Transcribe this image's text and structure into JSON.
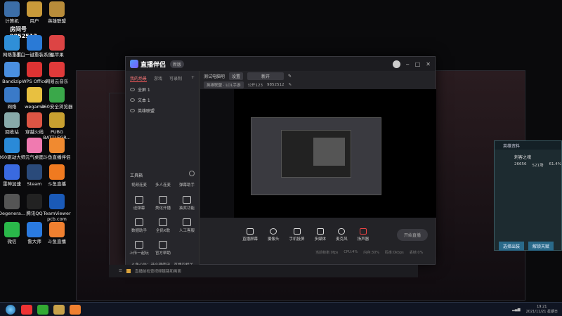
{
  "overlay": {
    "room_label": "房间号",
    "room_number": "9852512"
  },
  "desktop_icons": [
    {
      "label": "计算机",
      "color": "#3c6ea8"
    },
    {
      "label": "用户",
      "color": "#c99a3a"
    },
    {
      "label": "英雄联盟",
      "color": "#b88c3a"
    },
    {
      "label": "网络重置",
      "color": "#2f8fd8"
    },
    {
      "label": "小白一键重装系统",
      "color": "#2a7ad6"
    },
    {
      "label": "福苹果",
      "color": "#d44"
    },
    {
      "label": "Bandizip",
      "color": "#4a8fe0"
    },
    {
      "label": "WPS Office",
      "color": "#d33"
    },
    {
      "label": "网易云音乐",
      "color": "#e03a3a"
    },
    {
      "label": "网络",
      "color": "#3a7ac8"
    },
    {
      "label": "wegame",
      "color": "#e8c040"
    },
    {
      "label": "360安全浏览器",
      "color": "#3aa84a"
    },
    {
      "label": "回收站",
      "color": "#8aa"
    },
    {
      "label": "穿越火线",
      "color": "#d54"
    },
    {
      "label": "PUBG BATTLEGR...",
      "color": "#c8a030"
    },
    {
      "label": "360驱动大师",
      "color": "#2a8ad8"
    },
    {
      "label": "元气桌面",
      "color": "#f07ab0"
    },
    {
      "label": "斗鱼直播伴侣",
      "color": "#f08a30"
    },
    {
      "label": "雷神加速",
      "color": "#3a6ae0"
    },
    {
      "label": "Steam",
      "color": "#2a4a7a"
    },
    {
      "label": "斗鱼直播",
      "color": "#f07a20"
    },
    {
      "label": "Degenera...",
      "color": "#555"
    },
    {
      "label": "腾讯QQ",
      "color": "#222"
    },
    {
      "label": "TeamViewer pcb.com",
      "color": "#1a5ab8"
    },
    {
      "label": "微信",
      "color": "#2ab84a"
    },
    {
      "label": "鲁大师",
      "color": "#2a7ae0"
    },
    {
      "label": "斗鱼直播",
      "color": "#f08030"
    }
  ],
  "app": {
    "name": "直播伴侣",
    "version": "新版",
    "tabs": [
      "我的场景",
      "游戏",
      "可录制"
    ],
    "scenes": [
      "全屏 1",
      "文本 1",
      "英雄联盟"
    ],
    "tools_title": "工具箱",
    "tools": [
      "视频连麦",
      "多人连麦",
      "弹幕助手",
      "送弹幕",
      "美化开播",
      "抽奖功能",
      "数据助手",
      "全民K歌",
      "人工客服",
      "上传一起玩",
      "官方帮助"
    ],
    "preview_header": {
      "source": "测试电脑吧",
      "settings": "设置",
      "title": "新开"
    },
    "preview_sub": {
      "category": "英雄联盟 · LOL手游",
      "room_prefix": "公开123",
      "room_id": "9852512"
    },
    "bottom_actions": [
      "直播屏幕",
      "摄像头",
      "手机投屏",
      "多媒体",
      "麦克风",
      "扬声器"
    ],
    "start_live": "开始直播",
    "notice": "斗鱼公告：请合理使用，直播间相关，更上一层楼",
    "stats": [
      "当前帧率:0fps",
      "CPU:4%",
      "内存:30%",
      "码率:0kbps",
      "丢帧:0%"
    ],
    "footer_checkbox": "直播前检查视频链路和画面",
    "title_icons": [
      "minimize",
      "maximize",
      "close"
    ]
  },
  "hero_panel": {
    "header": "英雄资料",
    "name": "刺客之魂",
    "stats": [
      "26656",
      "521场",
      "61.4%"
    ],
    "buttons": [
      "选择出装",
      "解锁天赋"
    ]
  },
  "taskbar": {
    "clock_line1": "19:21",
    "clock_line2": "2021/11/21 星期日"
  }
}
